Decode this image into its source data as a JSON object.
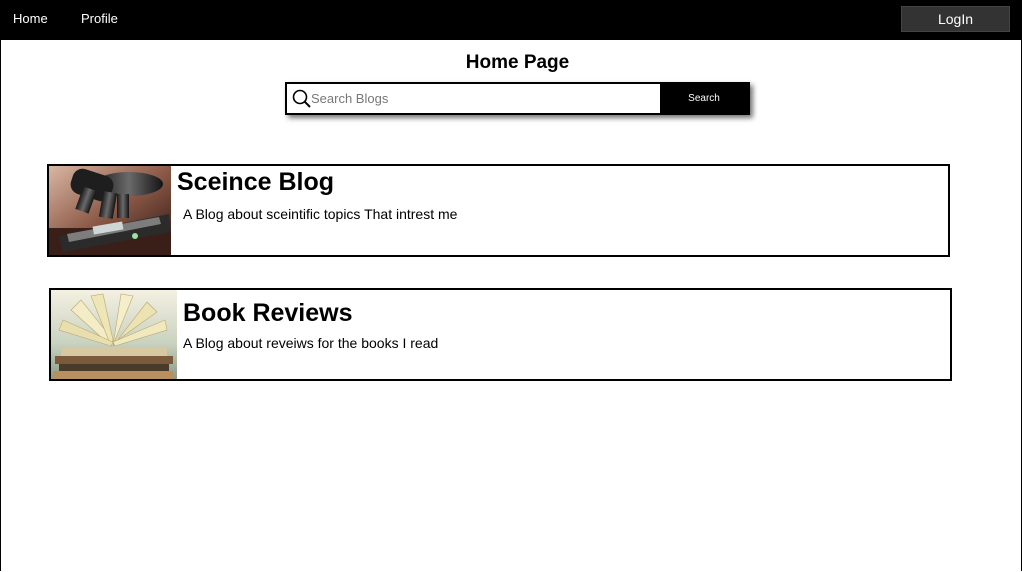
{
  "nav": {
    "home_label": "Home",
    "profile_label": "Profile",
    "login_label": "LogIn"
  },
  "page": {
    "title": "Home Page"
  },
  "search": {
    "placeholder": "Search Blogs",
    "value": "",
    "button_label": "Search",
    "icon": "search-icon"
  },
  "blogs": [
    {
      "title": "Sceince Blog",
      "description": "A Blog about sceintific topics That intrest me",
      "thumbnail": "microscope-image"
    },
    {
      "title": "Book Reviews",
      "description": "A Blog about reveiws for the books I read",
      "thumbnail": "open-book-image"
    }
  ],
  "colors": {
    "navbar_bg": "#000000",
    "login_bg": "#333333",
    "search_button_bg": "#000000",
    "text": "#000000",
    "background": "#ffffff"
  }
}
